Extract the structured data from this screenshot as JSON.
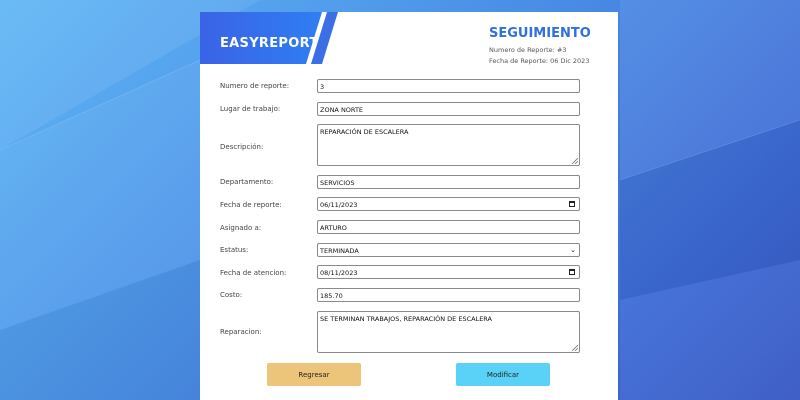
{
  "app": {
    "brand": "EASYREPORT"
  },
  "header": {
    "title": "SEGUIMIENTO",
    "report_number_line": "Numero de Reporte: #3",
    "report_date_line": "Fecha de Reporte: 06 Dic 2023"
  },
  "form": {
    "fields": [
      {
        "label": "Numero de reporte:",
        "value": "3"
      },
      {
        "label": "Lugar de trabajo:",
        "value": "ZONA NORTE"
      },
      {
        "label": "Descripción:",
        "value": "REPARACIÓN DE ESCALERA"
      },
      {
        "label": "Departamento:",
        "value": "SERVICIOS"
      },
      {
        "label": "Fecha de reporte:",
        "value": "06/11/2023"
      },
      {
        "label": "Asignado a:",
        "value": "ARTURO"
      },
      {
        "label": "Estatus:",
        "value": "TERMINADA"
      },
      {
        "label": "Fecha de atencion:",
        "value": "08/11/2023"
      },
      {
        "label": "Costo:",
        "value": "185.70"
      },
      {
        "label": "Reparacion:",
        "value": "SE TERMINAN TRABAJOS, REPARACIÓN DE ESCALERA"
      }
    ]
  },
  "actions": {
    "back_label": "Regresar",
    "modify_label": "Modificar"
  },
  "colors": {
    "brand_blue": "#2f6fe0",
    "back_button": "#ecc57a",
    "modify_button": "#5ad2f7"
  },
  "icons": {
    "calendar": "calendar-icon",
    "select": "chevron-down-icon",
    "resize": "resize-handle-icon"
  }
}
